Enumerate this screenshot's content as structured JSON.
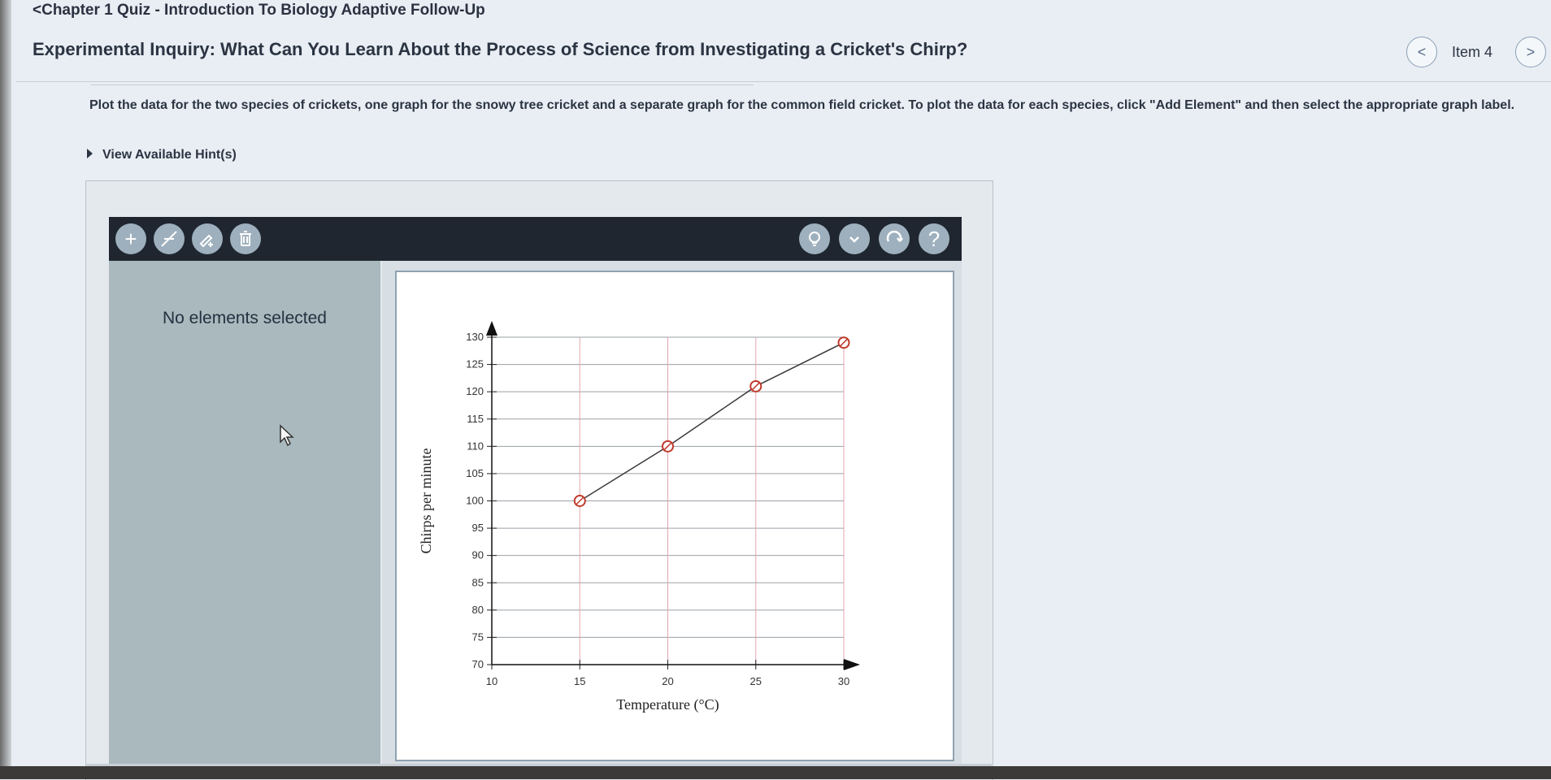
{
  "header": {
    "back_link": "<Chapter 1 Quiz - Introduction To Biology Adaptive Follow-Up",
    "title": "Experimental Inquiry: What Can You Learn About the Process of Science from Investigating a Cricket's Chirp?",
    "item_label": "Item 4",
    "prev_glyph": "<",
    "next_glyph": ">"
  },
  "instructions": "Plot the data for the two species of crickets, one graph for the snowy tree cricket and a separate graph for the common field cricket. To plot the data for each species, click \"Add Element\" and then select the appropriate graph label.",
  "hint_label": "View Available Hint(s)",
  "toolbar": {
    "left_icons": [
      "add-icon",
      "line-tool-icon",
      "edit-icon",
      "trash-icon"
    ],
    "right_icons": [
      "lightbulb-icon",
      "chevron-down-icon",
      "reset-icon",
      "help-icon"
    ],
    "help_glyph": "?",
    "add_glyph": "+",
    "button_color": "#9eb0bd",
    "bar_color": "#1f2630"
  },
  "side_panel": {
    "status_text": "No elements selected"
  },
  "chart_data": {
    "type": "line",
    "x": [
      15,
      20,
      25,
      30
    ],
    "series": [
      {
        "values": [
          100,
          110,
          121,
          129
        ]
      }
    ],
    "xlabel": "Temperature (°C)",
    "ylabel": "Chirps per minute",
    "xlim": [
      10,
      30
    ],
    "ylim": [
      70,
      130
    ],
    "xticks": [
      "10",
      "15",
      "20",
      "25",
      "30"
    ],
    "yticks": [
      "70",
      "75",
      "80",
      "85",
      "90",
      "95",
      "100",
      "105",
      "110",
      "115",
      "120",
      "125",
      "130"
    ],
    "grid": true,
    "point_color": "#c0392b",
    "line_color": "#3a3a3a"
  }
}
